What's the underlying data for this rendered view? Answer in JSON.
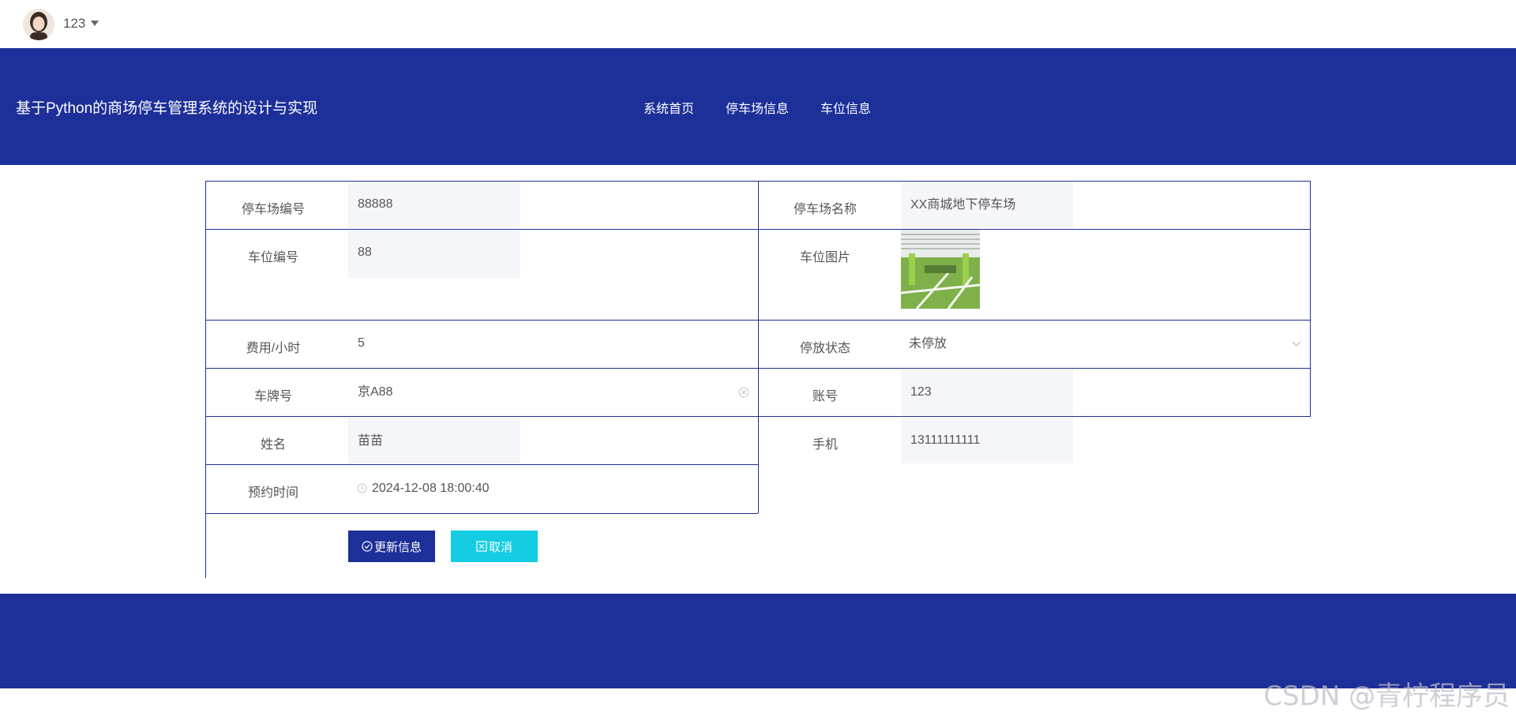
{
  "user": {
    "name": "123"
  },
  "header": {
    "title": "基于Python的商场停车管理系统的设计与实现",
    "nav": [
      "系统首页",
      "停车场信息",
      "车位信息"
    ]
  },
  "form": {
    "parking_lot_no": {
      "label": "停车场编号",
      "value": "88888"
    },
    "parking_lot_name": {
      "label": "停车场名称",
      "value": "XX商城地下停车场"
    },
    "space_no": {
      "label": "车位编号",
      "value": "88"
    },
    "space_image": {
      "label": "车位图片"
    },
    "fee": {
      "label": "费用/小时",
      "value": "5"
    },
    "status": {
      "label": "停放状态",
      "value": "未停放"
    },
    "plate": {
      "label": "车牌号",
      "value": "京A88"
    },
    "account": {
      "label": "账号",
      "value": "123"
    },
    "name": {
      "label": "姓名",
      "value": "苗苗"
    },
    "phone": {
      "label": "手机",
      "value": "13111111111"
    },
    "reserve_time": {
      "label": "预约时间",
      "value": "2024-12-08 18:00:40"
    }
  },
  "buttons": {
    "update": "更新信息",
    "cancel": "取消"
  },
  "watermark": "CSDN @青柠程序员",
  "colors": {
    "primary": "#1d2f98",
    "cancel": "#14cde3"
  }
}
